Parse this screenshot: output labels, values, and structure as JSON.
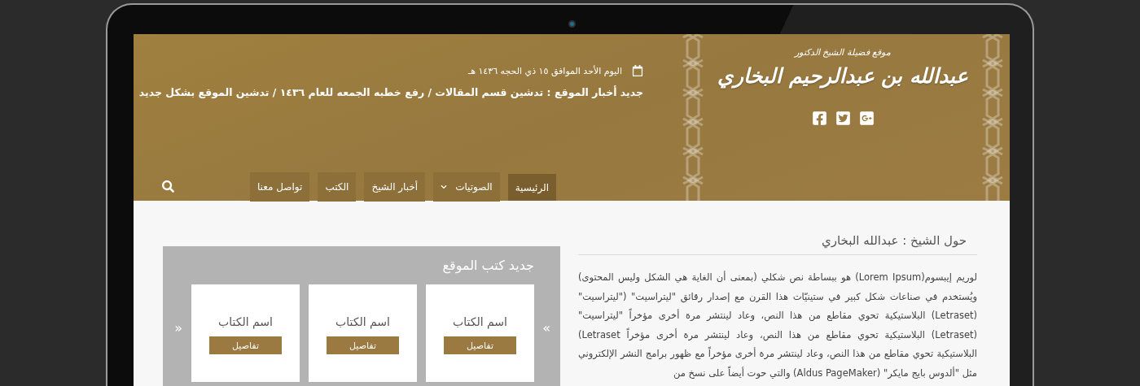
{
  "logo": {
    "subtitle": "موقع فضيلة الشيخ الدكتور",
    "name": "عبدالله بن عبدالرحيم البخاري"
  },
  "header": {
    "date": "اليوم الأحد الموافق ١٥ ذي الحجه ١٤٣٦ هـ",
    "news": "جديد أخبار الموقع : تدشين قسم المقالات / رفع خطبه الجمعه للعام ١٤٣٦ / تدشين الموقع بشكل جديد"
  },
  "nav": [
    {
      "label": "الرئيسية",
      "selected": true,
      "dropdown": false
    },
    {
      "label": "الصوتيات",
      "selected": false,
      "dropdown": true
    },
    {
      "label": "أخبار الشيخ",
      "selected": false,
      "dropdown": false
    },
    {
      "label": "الكتب",
      "selected": false,
      "dropdown": false
    },
    {
      "label": "تواصل معنا",
      "selected": false,
      "dropdown": false
    }
  ],
  "about": {
    "title": "حول الشيخ : عبدالله البخاري",
    "text": "لوريم إيبسوم(Lorem Ipsum) هو ببساطة نص شكلي (بمعنى أن الغاية هي الشكل وليس المحتوى) ويُستخدم في صناعات شكل كبير في ستينيّات هذا القرن مع إصدار رقائق \"ليتراسيت\" (\"ليتراسيت\" (Letraset) البلاستيكية تحوي مقاطع من هذا النص، وعاد لينتشر مرة أخرى مؤخراً \"ليتراسيت\" (Letraset) البلاستيكية تحوي مقاطع من هذا النص، وعاد لينتشر مرة أخرى مؤخراً Letraset) البلاستيكية تحوي مقاطع من هذا النص، وعاد لينتشر مرة أخرى مؤخراً مع ظهور برامج النشر الإلكتروني مثل \"ألدوس بايج مايكر\" (Aldus PageMaker) والتي حوت أيضاً على نسخ من"
  },
  "books": {
    "title": "جديد كتب الموقع",
    "prev": "«",
    "next": "»",
    "items": [
      {
        "name": "اسم الكتاب",
        "button": "تفاصيل"
      },
      {
        "name": "اسم الكتاب",
        "button": "تفاصيل"
      },
      {
        "name": "اسم الكتاب",
        "button": "تفاصيل"
      }
    ]
  }
}
